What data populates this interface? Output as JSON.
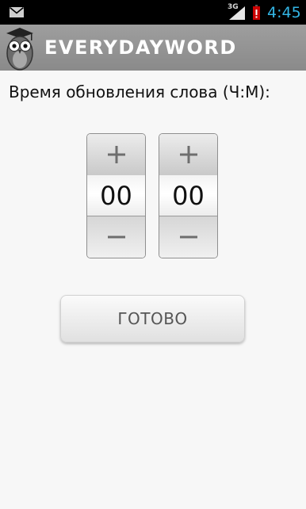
{
  "status_bar": {
    "network_type": "3G",
    "time": "4:45",
    "notification_icon": "envelope-icon",
    "signal_icon": "signal-icon",
    "battery_icon": "battery-low-icon",
    "time_color": "#33b5e5",
    "battery_color": "#cc0000"
  },
  "app_bar": {
    "title": "EVERYDAYWORD",
    "logo_icon": "owl-icon"
  },
  "main": {
    "prompt": "Время обновления слова (Ч:М):",
    "hours": {
      "value": "00",
      "increment_icon": "plus-icon",
      "decrement_icon": "minus-icon"
    },
    "minutes": {
      "value": "00",
      "increment_icon": "plus-icon",
      "decrement_icon": "minus-icon"
    },
    "done_label": "ГОТОВО"
  }
}
